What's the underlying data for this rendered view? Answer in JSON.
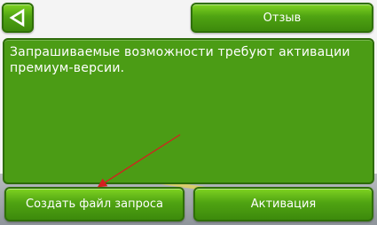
{
  "header": {
    "back_icon": "back-arrow-icon",
    "feedback_label": "Отзыв"
  },
  "panel": {
    "message": "Запрашиваемые возможности требуют активации премиум-версии."
  },
  "footer": {
    "create_request_label": "Создать файл запроса",
    "activation_label": "Активация"
  },
  "colors": {
    "button_green": "#4fa312",
    "panel_green": "#4b9c15",
    "annotation_arrow": "#d42020"
  }
}
